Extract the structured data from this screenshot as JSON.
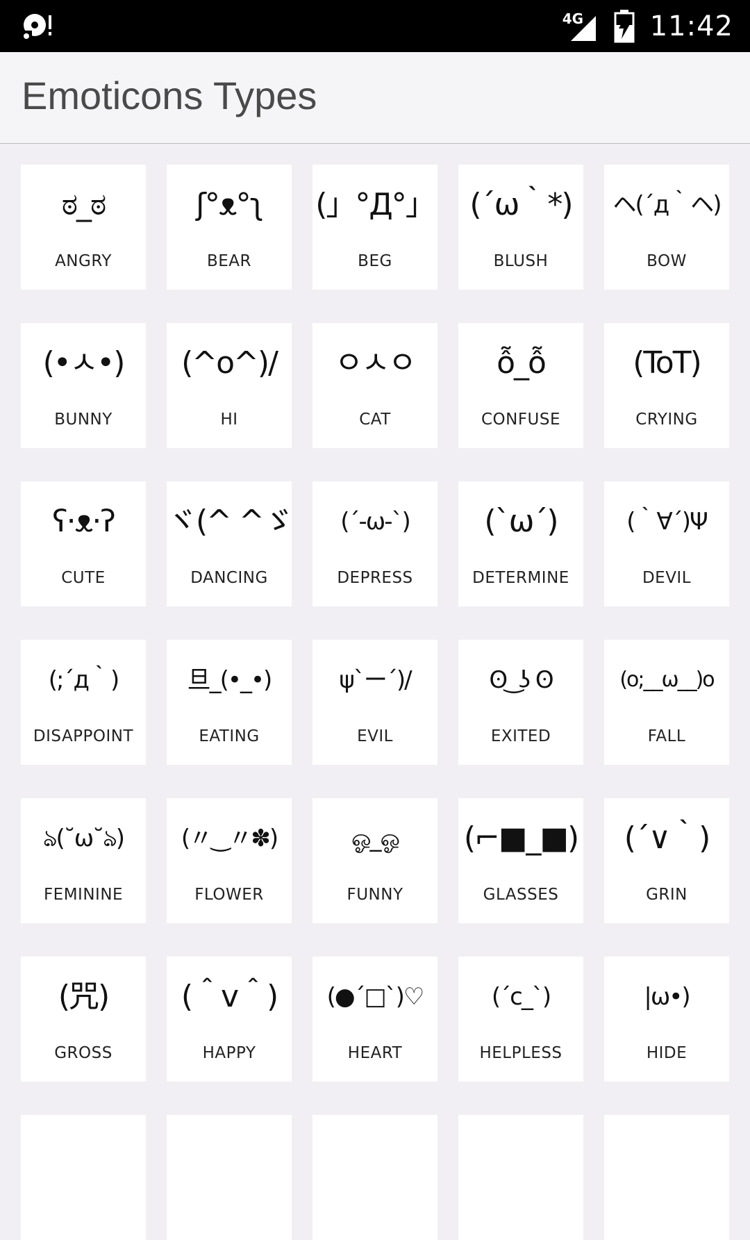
{
  "status_bar": {
    "network": "4G",
    "time": "11:42"
  },
  "app_bar": {
    "title": "Emoticons Types"
  },
  "emoticons": [
    {
      "face": "ಠ_ಠ",
      "label": "ANGRY"
    },
    {
      "face": "ʃ°ᴥ°ʅ",
      "label": "BEAR"
    },
    {
      "face": "(」°Д°」",
      "label": "BEG"
    },
    {
      "face": "(´ω｀*)",
      "label": "BLUSH"
    },
    {
      "face": "ヘ(´д｀ヘ)",
      "label": "BOW"
    },
    {
      "face": "(•ㅅ•)",
      "label": "BUNNY"
    },
    {
      "face": "(^o^)/",
      "label": "HI"
    },
    {
      "face": "ㅇㅅㅇ",
      "label": "CAT"
    },
    {
      "face": "ỗ_ỗ",
      "label": "CONFUSE"
    },
    {
      "face": "(ToT)",
      "label": "CRYING"
    },
    {
      "face": "ʕ·ᴥ·ʔ",
      "label": "CUTE"
    },
    {
      "face": "ヾ(^ ^ゞ",
      "label": "DANCING"
    },
    {
      "face": "(´-ω-`)",
      "label": "DEPRESS"
    },
    {
      "face": "(`ω´)",
      "label": "DETERMINE"
    },
    {
      "face": "(｀∀´)Ψ",
      "label": "DEVIL"
    },
    {
      "face": "(;´д｀)",
      "label": "DISAPPOINT"
    },
    {
      "face": "旦_(•_•)",
      "label": "EATING"
    },
    {
      "face": "ψ`ー´)/",
      "label": "EVIL"
    },
    {
      "face": "ʘ ͜ ʖ ʘ",
      "label": "EXITED"
    },
    {
      "face": "(o;__ω__)o",
      "label": "FALL"
    },
    {
      "face": "ঌ(˘ω˘ঌ)",
      "label": "FEMININE"
    },
    {
      "face": "(〃‿〃✽)",
      "label": "FLOWER"
    },
    {
      "face": "ஓ_ஓ",
      "label": "FUNNY"
    },
    {
      "face": "(⌐■_■)",
      "label": "GLASSES"
    },
    {
      "face": "(´∨｀)",
      "label": "GRIN"
    },
    {
      "face": "(咒)",
      "label": "GROSS"
    },
    {
      "face": "(＾v＾)",
      "label": "HAPPY"
    },
    {
      "face": "(●´□`)♡",
      "label": "HEART"
    },
    {
      "face": "(´c_`)",
      "label": "HELPLESS"
    },
    {
      "face": "|ω•)",
      "label": "HIDE"
    }
  ],
  "icons": {
    "status_left": "notification-icon",
    "signal": "signal-icon",
    "battery": "battery-charging-icon"
  },
  "colors": {
    "status_bar_bg": "#000000",
    "app_bar_bg": "#f5f4f7",
    "page_bg": "#f1eff3",
    "tile_bg": "#ffffff",
    "title_text": "#4a4a4a"
  }
}
